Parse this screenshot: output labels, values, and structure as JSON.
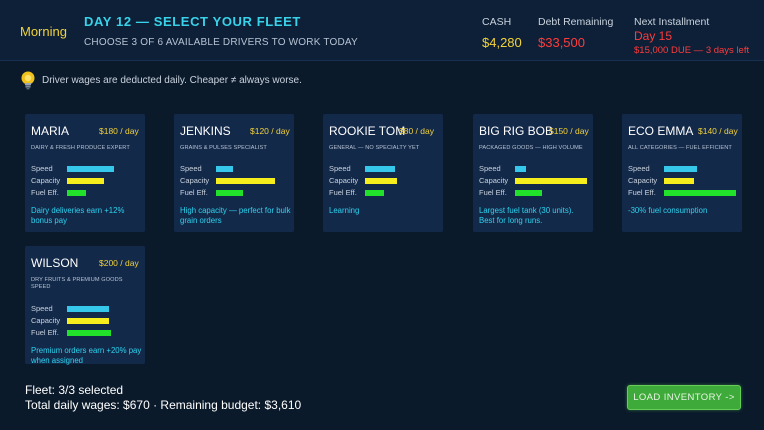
{
  "header": {
    "time_of_day": "Morning",
    "title": "DAY 12 — SELECT YOUR FLEET",
    "subtitle": "CHOOSE 3 OF 6 AVAILABLE DRIVERS TO WORK TODAY",
    "cash_label": "CASH",
    "cash_value": "$4,280",
    "debt_label": "Debt Remaining",
    "debt_value": "$33,500",
    "installment_label": "Next Installment",
    "installment_day": "Day 15",
    "installment_due": "$15,000 DUE — 3 days left"
  },
  "tip": {
    "icon": "lightbulb-icon",
    "text": "Driver wages are deducted daily. Cheaper ≠ always worse."
  },
  "stat_labels": {
    "speed": "Speed",
    "capacity": "Capacity",
    "fuel": "Fuel Eff."
  },
  "drivers": [
    {
      "name": "MARIA",
      "wage": "$180 / day",
      "specialty": "DAIRY & FRESH PRODUCE EXPERT",
      "speed": 0.65,
      "capacity": 0.52,
      "fuel": 0.26,
      "perk": "Dairy deliveries earn +12% bonus pay"
    },
    {
      "name": "JENKINS",
      "wage": "$120 / day",
      "specialty": "GRAINS & PULSES SPECIALIST",
      "speed": 0.24,
      "capacity": 0.82,
      "fuel": 0.37,
      "perk": "High capacity — perfect for bulk grain orders"
    },
    {
      "name": "ROOKIE TOM",
      "wage": "$80 / day",
      "specialty": "GENERAL — NO SPECIALTY YET",
      "speed": 0.41,
      "capacity": 0.44,
      "fuel": 0.26,
      "perk": "Learning"
    },
    {
      "name": "BIG RIG BOB",
      "wage": "$150 / day",
      "specialty": "PACKAGED GOODS — HIGH VOLUME",
      "speed": 0.15,
      "capacity": 1.0,
      "fuel": 0.37,
      "perk": "Largest fuel tank (30 units). Best for long runs."
    },
    {
      "name": "ECO EMMA",
      "wage": "$140 / day",
      "specialty": "ALL CATEGORIES — FUEL EFFICIENT",
      "speed": 0.46,
      "capacity": 0.41,
      "fuel": 1.0,
      "perk": "-30% fuel consumption"
    },
    {
      "name": "WILSON",
      "wage": "$200 / day",
      "specialty": "DRY FRUITS & PREMIUM GOODS SPEED",
      "speed": 0.59,
      "capacity": 0.59,
      "fuel": 0.61,
      "perk": "Premium orders earn +20% pay when assigned"
    }
  ],
  "footer": {
    "fleet_count": "Fleet: 3/3 selected",
    "wages_summary": "Total daily wages: $670 · Remaining budget: $3,610",
    "load_button": "LOAD INVENTORY ->"
  }
}
